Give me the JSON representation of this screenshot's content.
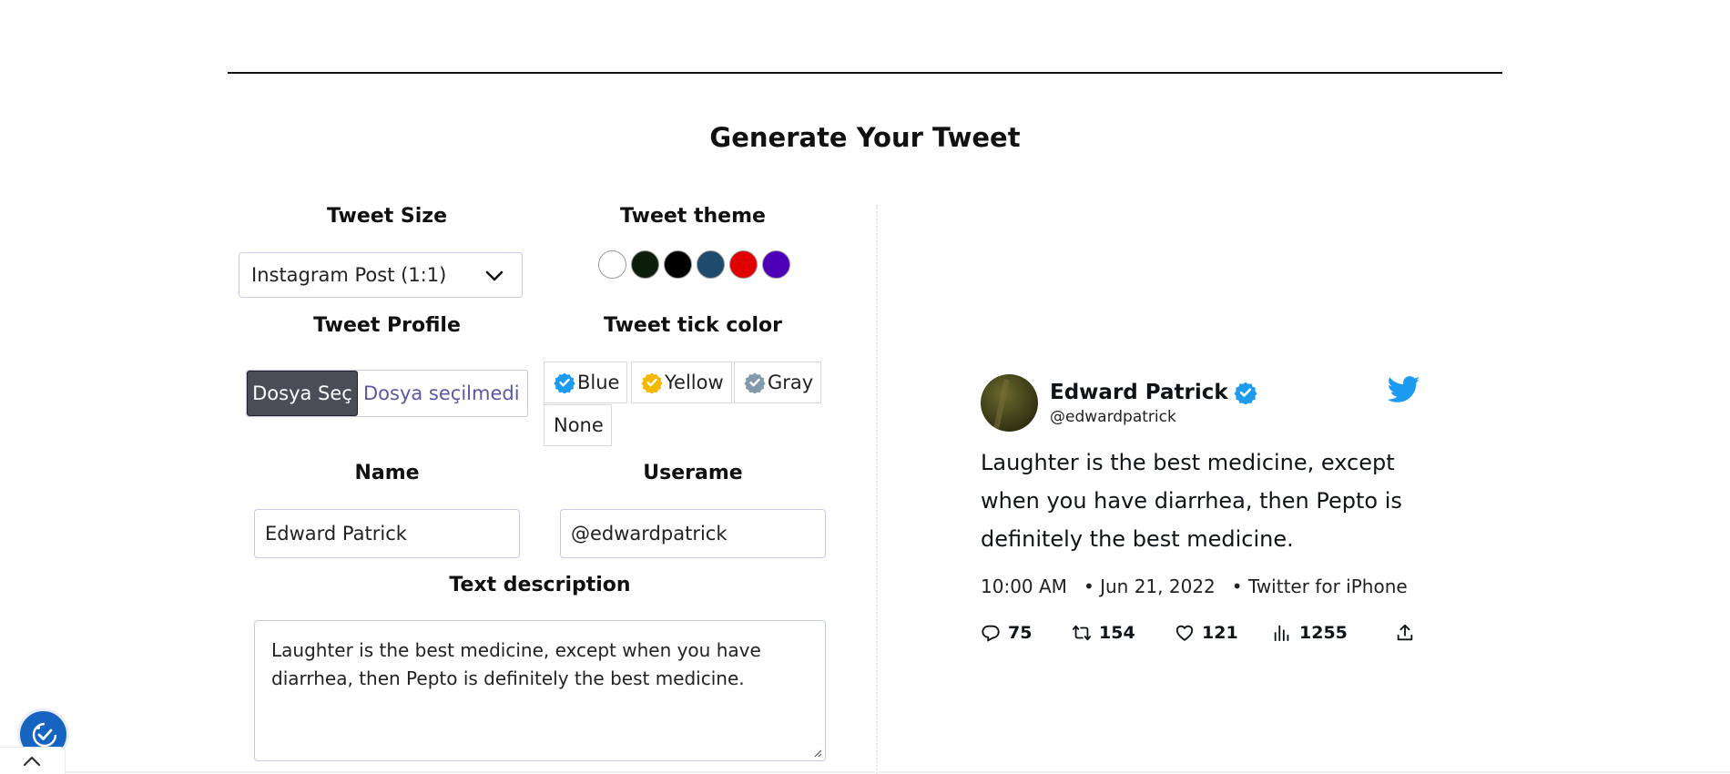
{
  "page_title": "Generate Your Tweet",
  "form": {
    "tweet_size": {
      "label": "Tweet Size",
      "selected": "Instagram Post (1:1)"
    },
    "tweet_theme": {
      "label": "Tweet theme",
      "colors": [
        "#ffffff",
        "#0b1f0b",
        "#000000",
        "#1e4a6e",
        "#e00000",
        "#4d00b8"
      ]
    },
    "tweet_profile": {
      "label": "Tweet Profile",
      "button_label": "Dosya Seç",
      "file_status": "Dosya seçilmedi"
    },
    "tick_color": {
      "label": "Tweet tick color",
      "options": [
        {
          "label": "Blue",
          "color": "#1d9bf0"
        },
        {
          "label": "Yellow",
          "color": "#f4b800"
        },
        {
          "label": "Gray",
          "color": "#829aab"
        },
        {
          "label": "None"
        }
      ]
    },
    "name": {
      "label": "Name",
      "value": "Edward Patrick"
    },
    "username": {
      "label": "Userame",
      "value": "@edwardpatrick"
    },
    "description": {
      "label": "Text description",
      "value": "Laughter is the best medicine, except when you have diarrhea, then Pepto is definitely the best medicine."
    }
  },
  "tweet": {
    "name": "Edward Patrick",
    "username": "@edwardpatrick",
    "text": "Laughter is the best medicine, except when you have diarrhea, then Pepto is definitely the best medicine.",
    "time": "10:00 AM",
    "date": "• Jun 21, 2022",
    "source": "• Twitter for iPhone",
    "stats": {
      "replies": "75",
      "retweets": "154",
      "likes": "121",
      "views": "1255"
    },
    "accent": "#1d9bf0"
  },
  "icons": [
    "chevron-down-icon",
    "verified-badge-icon",
    "twitter-bird-icon",
    "reply-icon",
    "retweet-icon",
    "heart-icon",
    "views-icon",
    "share-icon",
    "accessibility-icon",
    "chevron-up-icon"
  ]
}
